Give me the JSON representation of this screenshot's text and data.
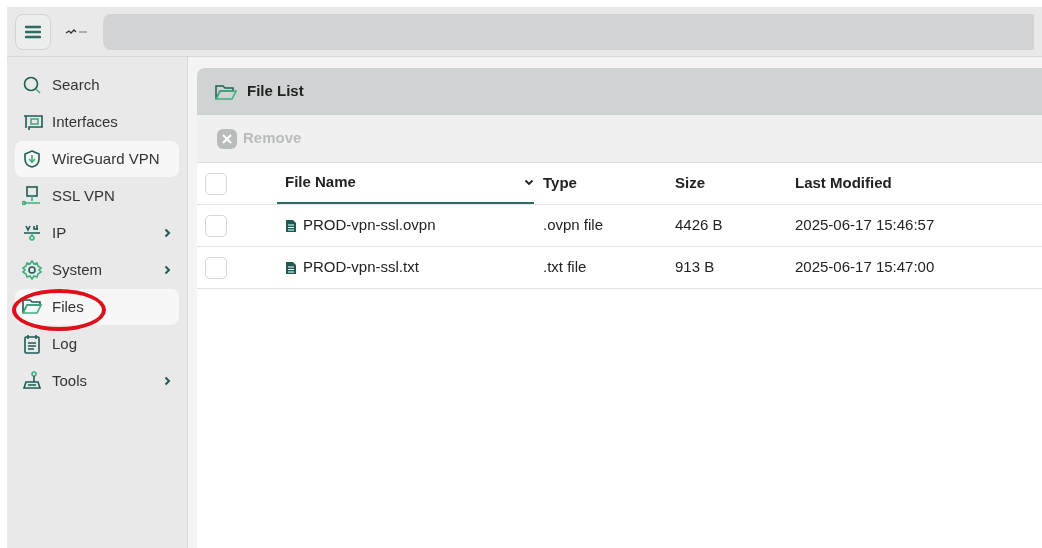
{
  "sidebar": {
    "items": [
      {
        "label": "Search",
        "kind": "search",
        "selected": false,
        "expandable": false
      },
      {
        "label": "Interfaces",
        "kind": "interfaces",
        "selected": false,
        "expandable": false
      },
      {
        "label": "WireGuard VPN",
        "kind": "shield",
        "selected": true,
        "expandable": false
      },
      {
        "label": "SSL VPN",
        "kind": "network",
        "selected": false,
        "expandable": false
      },
      {
        "label": "IP",
        "kind": "ip",
        "selected": false,
        "expandable": true
      },
      {
        "label": "System",
        "kind": "gear",
        "selected": false,
        "expandable": true
      },
      {
        "label": "Files",
        "kind": "folder",
        "selected": true,
        "expandable": false
      },
      {
        "label": "Log",
        "kind": "log",
        "selected": false,
        "expandable": false
      },
      {
        "label": "Tools",
        "kind": "tools",
        "selected": false,
        "expandable": true
      }
    ]
  },
  "panel": {
    "title": "File List",
    "toolbar": [
      {
        "label": "Remove",
        "disabled": true
      }
    ],
    "table": {
      "select_all_checked": false,
      "columns": [
        {
          "label": "File Name",
          "sorted": true
        },
        {
          "label": "Type",
          "sorted": false
        },
        {
          "label": "Size",
          "sorted": false
        },
        {
          "label": "Last Modified",
          "sorted": false
        }
      ],
      "rows": [
        {
          "checked": false,
          "cells": [
            "PROD-vpn-ssl.ovpn",
            ".ovpn file",
            "4426 B",
            "2025-06-17 15:46:57"
          ]
        },
        {
          "checked": false,
          "cells": [
            "PROD-vpn-ssl.txt",
            ".txt file",
            "913 B",
            "2025-06-17 15:47:00"
          ]
        }
      ]
    }
  }
}
